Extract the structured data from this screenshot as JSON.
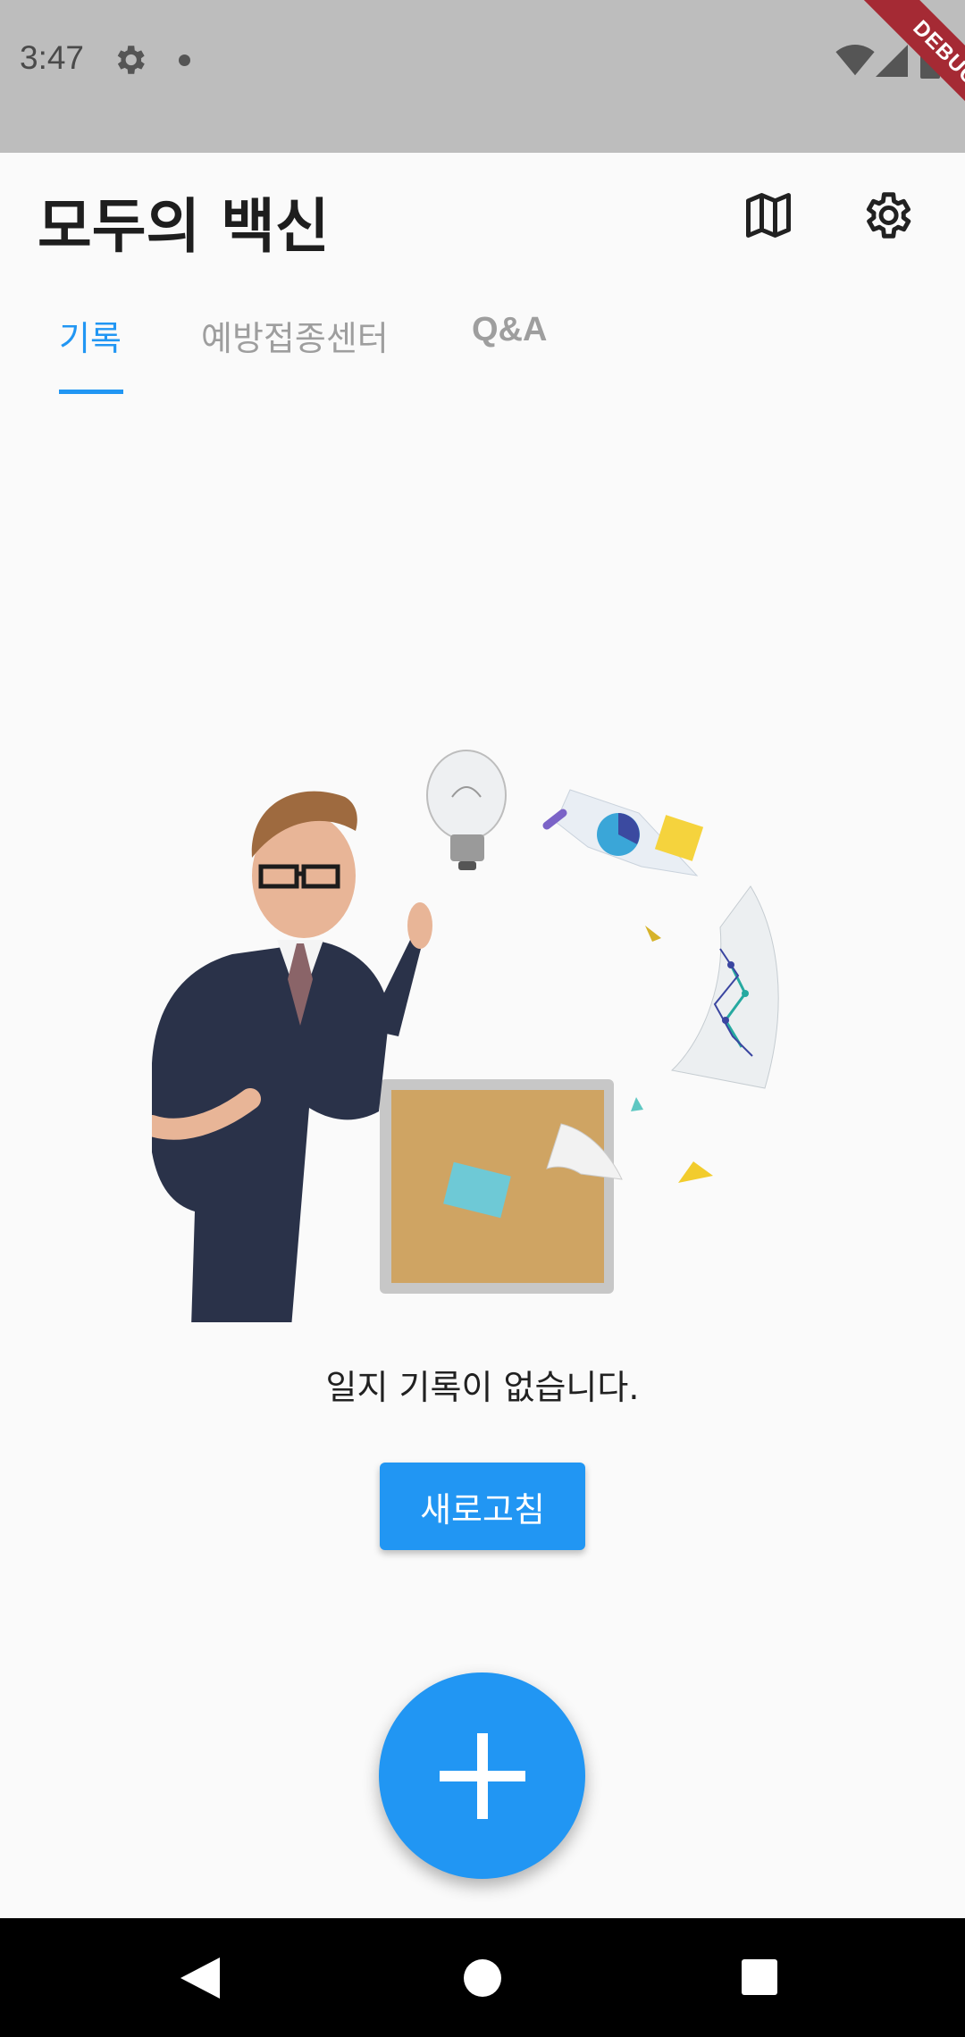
{
  "status_bar": {
    "time": "3:47",
    "icons": [
      "gear-icon",
      "notification-dot-icon",
      "wifi-icon",
      "signal-icon",
      "battery-icon"
    ],
    "debug_banner": "DEBUG"
  },
  "app_bar": {
    "title": "모두의 백신",
    "actions": [
      "map-icon",
      "settings-icon"
    ]
  },
  "tabs": [
    {
      "label": "기록",
      "selected": true
    },
    {
      "label": "예방접종센터",
      "selected": false
    },
    {
      "label": "Q&A",
      "selected": false
    }
  ],
  "empty_state": {
    "message": "일지 기록이 없습니다.",
    "refresh_label": "새로고침"
  },
  "fab": {
    "icon": "add-icon"
  },
  "navigation_bar": {
    "buttons": [
      "back-icon",
      "home-icon",
      "recents-icon"
    ]
  },
  "colors": {
    "accent": "#2196f3",
    "status_bar": "#bdbdbd",
    "background": "#fafafa",
    "debug_banner": "#a52a34"
  }
}
